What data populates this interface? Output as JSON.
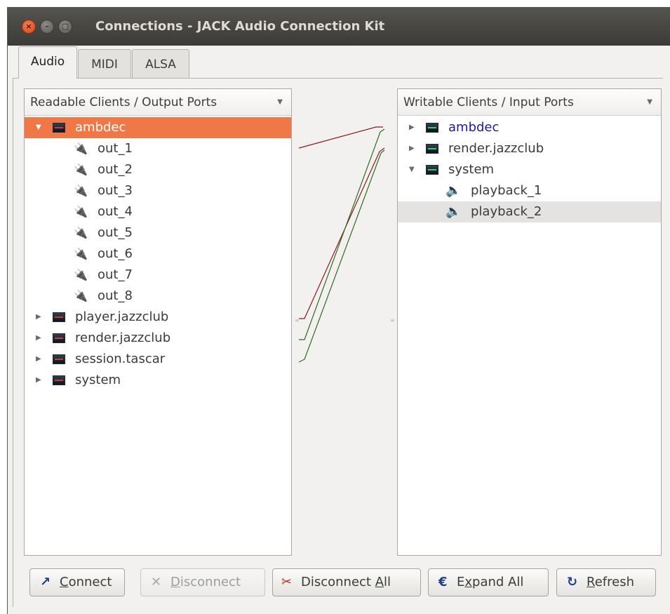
{
  "window": {
    "title": "Connections - JACK Audio Connection Kit"
  },
  "tabs": [
    {
      "label": "Audio"
    },
    {
      "label": "MIDI"
    },
    {
      "label": "ALSA"
    }
  ],
  "left": {
    "header": "Readable Clients / Output Ports",
    "clients": [
      {
        "label": "ambdec",
        "expanded": true,
        "selected": true,
        "ports": [
          "out_1",
          "out_2",
          "out_3",
          "out_4",
          "out_5",
          "out_6",
          "out_7",
          "out_8"
        ]
      },
      {
        "label": "player.jazzclub"
      },
      {
        "label": "render.jazzclub"
      },
      {
        "label": "session.tascar"
      },
      {
        "label": "system"
      }
    ]
  },
  "right": {
    "header": "Writable Clients / Input Ports",
    "clients": [
      {
        "label": "ambdec",
        "highlight": true
      },
      {
        "label": "render.jazzclub"
      },
      {
        "label": "system",
        "expanded": true,
        "ports": [
          "playback_1",
          "playback_2"
        ]
      }
    ]
  },
  "buttons": {
    "connect": {
      "pre": "",
      "accel": "C",
      "post": "onnect"
    },
    "disconnect": {
      "pre": "",
      "accel": "D",
      "post": "isconnect"
    },
    "disconnect_all": {
      "pre": "Disconnect ",
      "accel": "A",
      "post": "ll"
    },
    "expand_all": {
      "pre": "E",
      "accel": "x",
      "post": "pand All"
    },
    "refresh": {
      "pre": "",
      "accel": "R",
      "post": "efresh"
    }
  },
  "icons": {
    "plug": "plug-icon",
    "speaker": "speaker-icon",
    "client": "jack-client-icon"
  },
  "colors": {
    "selection": "#f07746",
    "connection_red": "#8b1a1a",
    "connection_green": "#2e6b1e",
    "client_link": "#1a1aa8"
  }
}
